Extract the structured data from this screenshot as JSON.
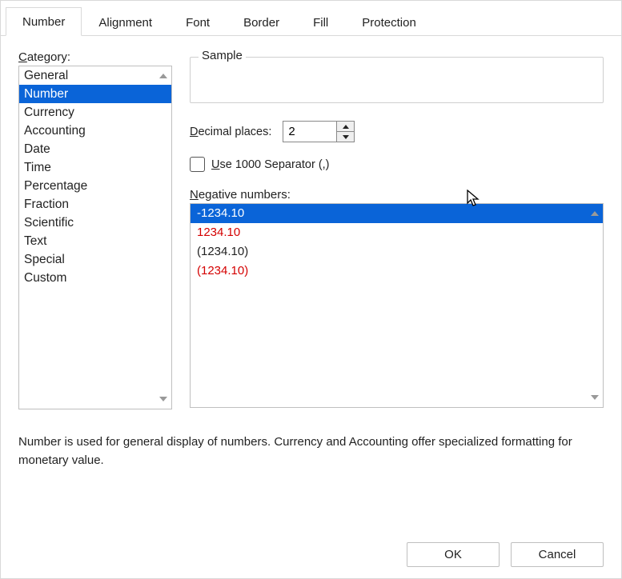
{
  "tabs": [
    {
      "label": "Number",
      "active": true
    },
    {
      "label": "Alignment",
      "active": false
    },
    {
      "label": "Font",
      "active": false
    },
    {
      "label": "Border",
      "active": false
    },
    {
      "label": "Fill",
      "active": false
    },
    {
      "label": "Protection",
      "active": false
    }
  ],
  "category": {
    "label": "Category:",
    "label_ul": "C",
    "items": [
      {
        "label": "General",
        "selected": false
      },
      {
        "label": "Number",
        "selected": true
      },
      {
        "label": "Currency",
        "selected": false
      },
      {
        "label": "Accounting",
        "selected": false
      },
      {
        "label": "Date",
        "selected": false
      },
      {
        "label": "Time",
        "selected": false
      },
      {
        "label": "Percentage",
        "selected": false
      },
      {
        "label": "Fraction",
        "selected": false
      },
      {
        "label": "Scientific",
        "selected": false
      },
      {
        "label": "Text",
        "selected": false
      },
      {
        "label": "Special",
        "selected": false
      },
      {
        "label": "Custom",
        "selected": false
      }
    ]
  },
  "sample": {
    "legend": "Sample",
    "value": ""
  },
  "decimal": {
    "label_pre": "",
    "label_ul": "D",
    "label_post": "ecimal places:",
    "value": "2"
  },
  "separator": {
    "checked": false,
    "label_ul": "U",
    "label_post": "se 1000 Separator (,)"
  },
  "negative": {
    "label_ul": "N",
    "label_post": "egative numbers:",
    "items": [
      {
        "text": "-1234.10",
        "selected": true,
        "red": false
      },
      {
        "text": "1234.10",
        "selected": false,
        "red": true
      },
      {
        "text": "(1234.10)",
        "selected": false,
        "red": false
      },
      {
        "text": "(1234.10)",
        "selected": false,
        "red": true
      }
    ]
  },
  "description": "Number is used for general display of numbers.  Currency and Accounting offer specialized formatting for monetary value.",
  "buttons": {
    "ok": "OK",
    "cancel": "Cancel"
  }
}
